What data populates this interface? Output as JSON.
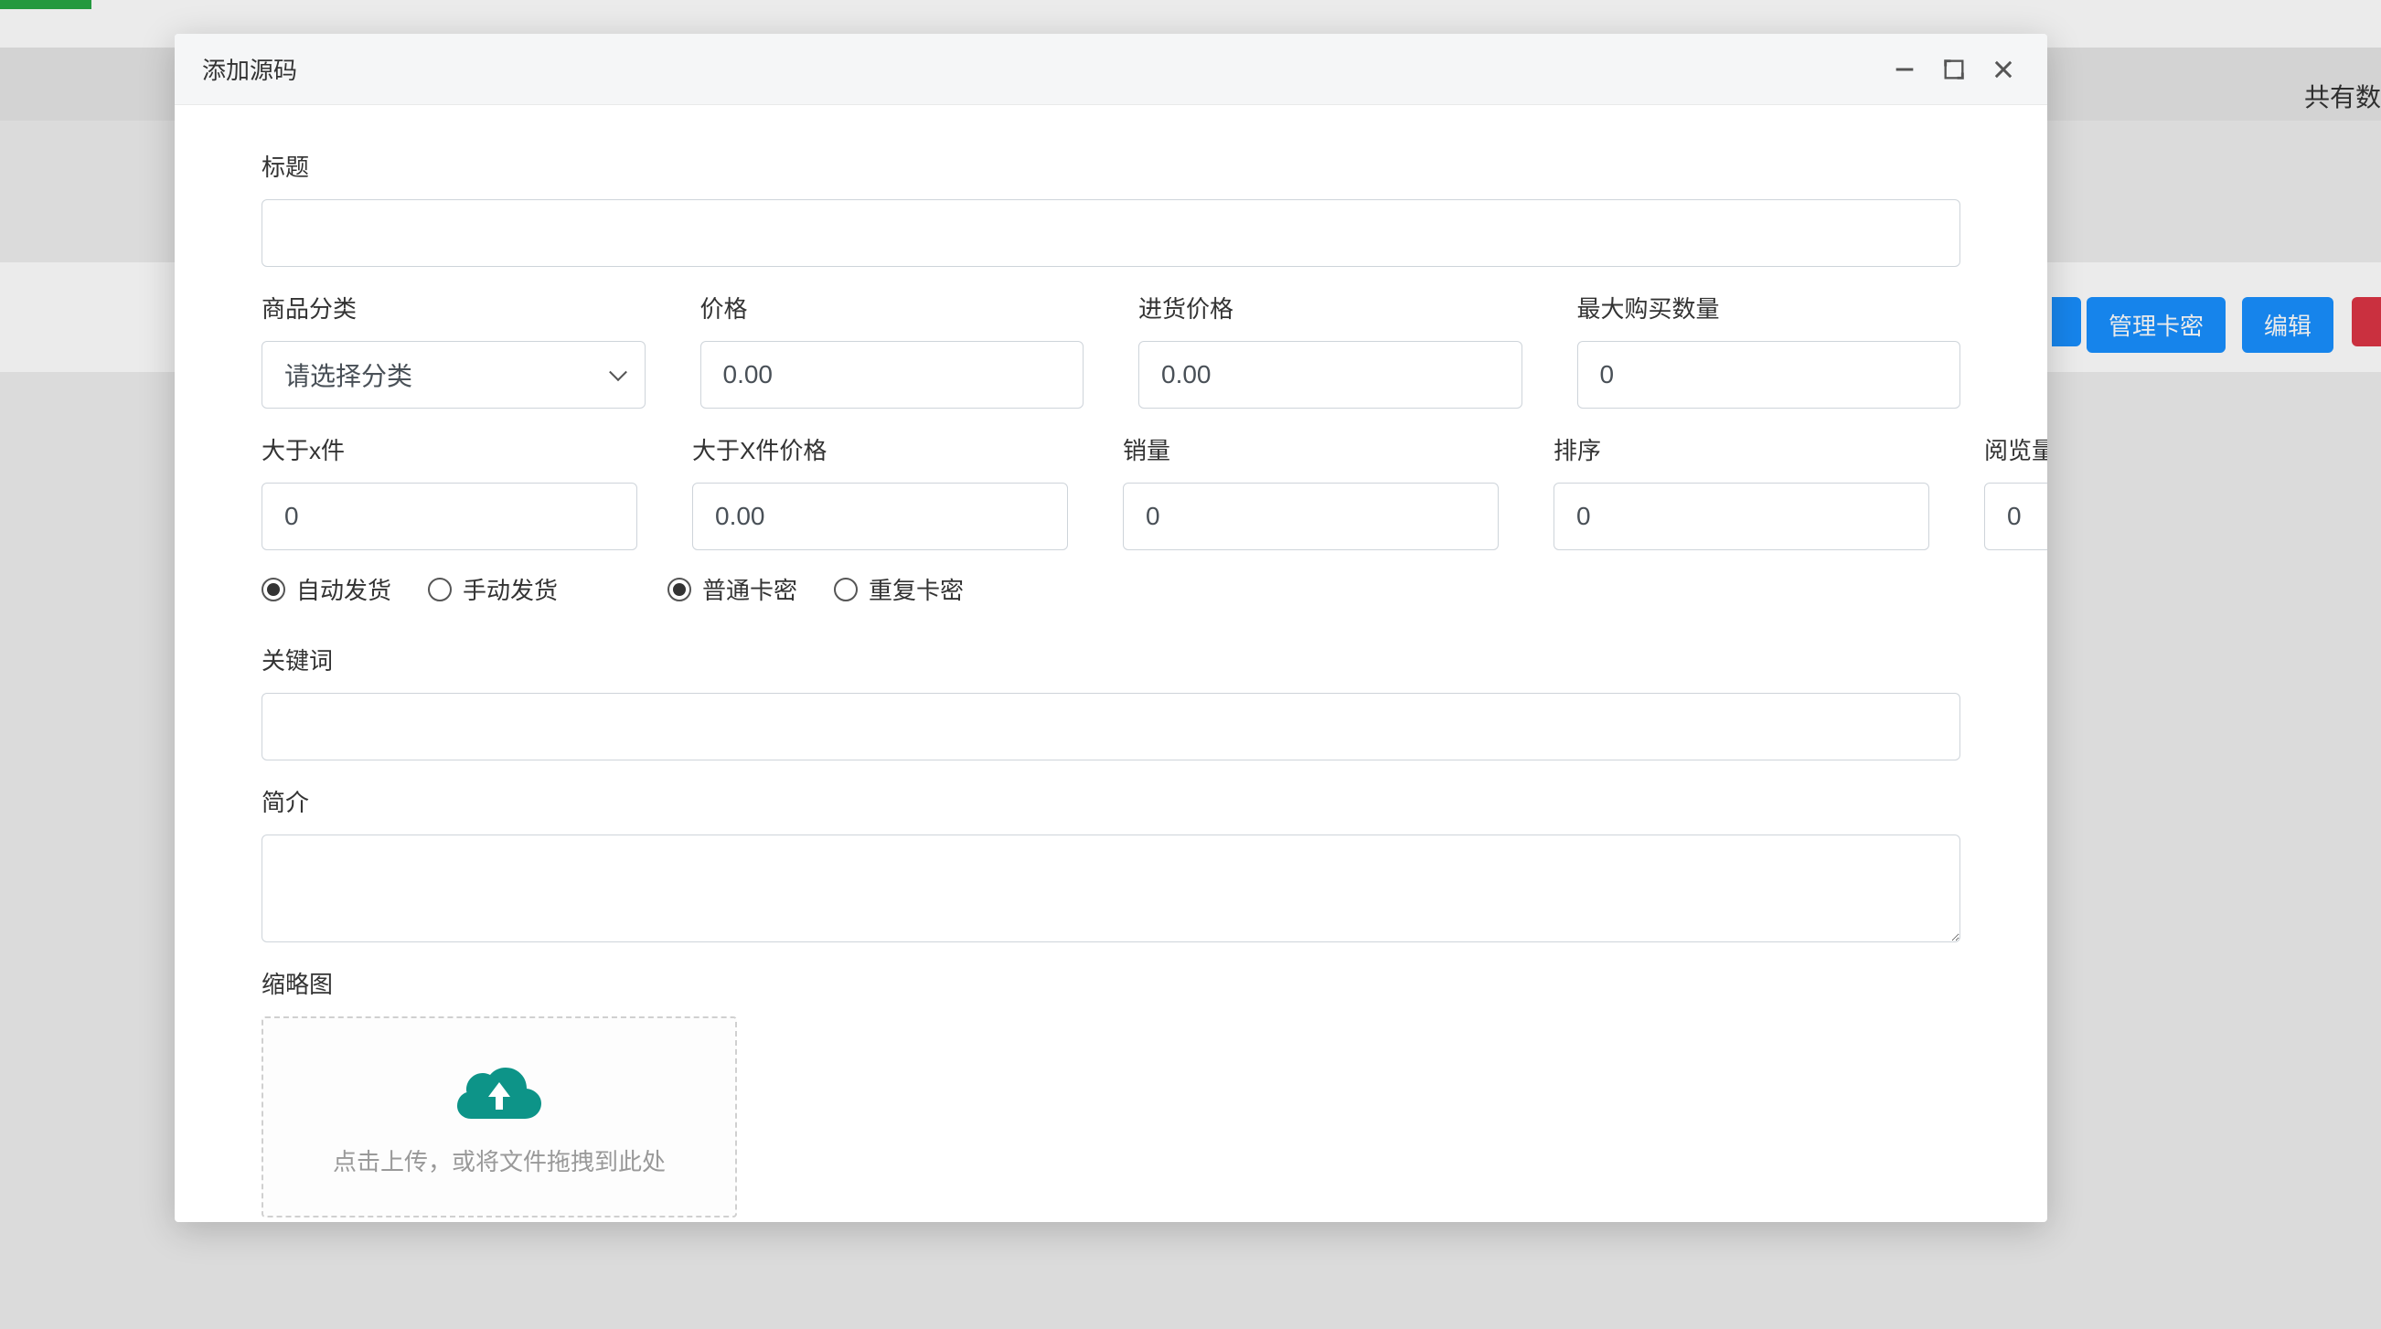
{
  "background": {
    "rightText": "共有数",
    "manageBtn": "管理卡密",
    "editBtn": "编辑"
  },
  "modal": {
    "title": "添加源码"
  },
  "form": {
    "titleLabel": "标题",
    "titleValue": "",
    "categoryLabel": "商品分类",
    "categoryPlaceholder": "请选择分类",
    "priceLabel": "价格",
    "priceValue": "0.00",
    "purchasePriceLabel": "进货价格",
    "purchasePriceValue": "0.00",
    "maxBuyLabel": "最大购买数量",
    "maxBuyValue": "0",
    "gtXLabel": "大于x件",
    "gtXValue": "0",
    "gtXPriceLabel": "大于X件价格",
    "gtXPriceValue": "0.00",
    "salesLabel": "销量",
    "salesValue": "0",
    "sortLabel": "排序",
    "sortValue": "0",
    "viewsLabel": "阅览量",
    "viewsValue": "0",
    "shipRadio": {
      "auto": "自动发货",
      "manual": "手动发货"
    },
    "cardRadio": {
      "normal": "普通卡密",
      "repeat": "重复卡密"
    },
    "keywordLabel": "关键词",
    "keywordValue": "",
    "introLabel": "简介",
    "introValue": "",
    "thumbLabel": "缩略图",
    "uploadText": "点击上传，或将文件拖拽到此处"
  }
}
